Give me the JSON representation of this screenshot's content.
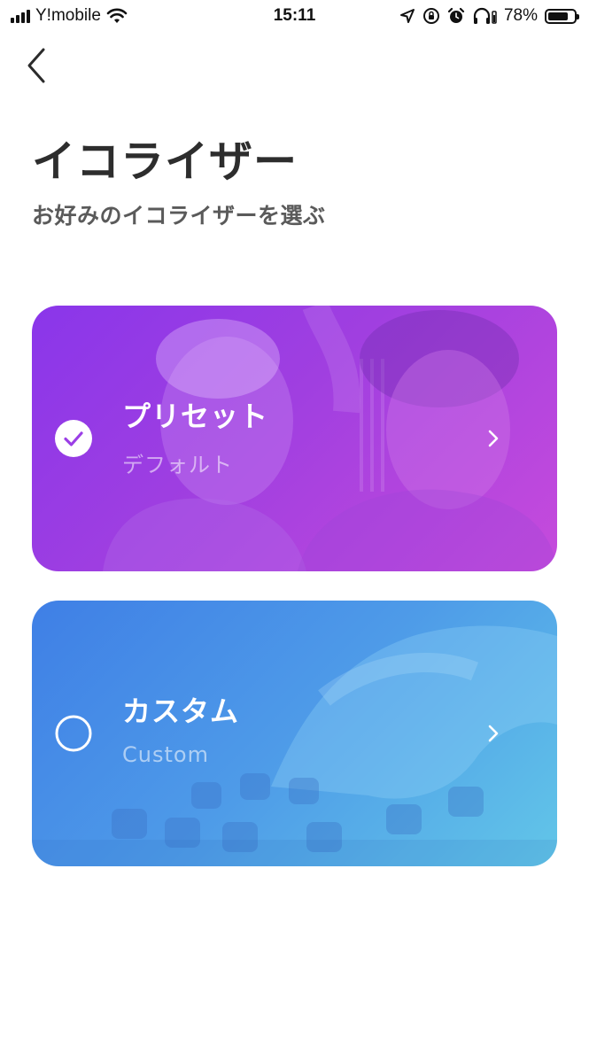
{
  "status_bar": {
    "carrier": "Y!mobile",
    "time": "15:11",
    "battery_percent": "78%",
    "battery_level": 0.78,
    "icons": [
      "signal-icon",
      "wifi-icon",
      "location-icon",
      "orientation-lock-icon",
      "alarm-icon",
      "headphones-icon",
      "battery-icon"
    ]
  },
  "header": {
    "back_icon": "chevron-left-icon",
    "title": "イコライザー",
    "subtitle": "お好みのイコライザーを選ぶ"
  },
  "options": [
    {
      "title": "プリセット",
      "subtitle": "デフォルト",
      "selected": true,
      "select_icon": "check-circle-icon",
      "arrow_icon": "chevron-right-icon",
      "color": "#9b3fe6"
    },
    {
      "title": "カスタム",
      "subtitle": "Custom",
      "selected": false,
      "select_icon": "empty-circle-icon",
      "arrow_icon": "chevron-right-icon",
      "color": "#4d96e8"
    }
  ]
}
